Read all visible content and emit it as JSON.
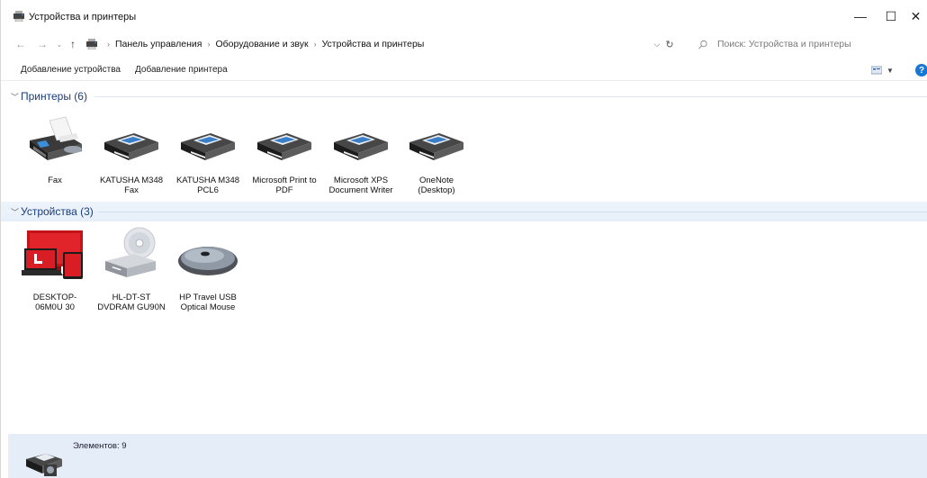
{
  "window": {
    "title": "Устройства и принтеры",
    "minimize": "—",
    "maximize": "☐",
    "close": "✕"
  },
  "address": {
    "path": [
      "Панель управления",
      "Оборудование и звук",
      "Устройства и принтеры"
    ],
    "search_placeholder": "Поиск: Устройства и принтеры"
  },
  "toolbar": {
    "add_device": "Добавление устройства",
    "add_printer": "Добавление принтера",
    "help": "?"
  },
  "groups": {
    "printers": {
      "title": "Принтеры (6)",
      "items": [
        {
          "label": "Fax",
          "icon": "fax-icon"
        },
        {
          "label": "KATUSHA M348 Fax",
          "icon": "printer-icon"
        },
        {
          "label": "KATUSHA M348 PCL6",
          "icon": "printer-icon"
        },
        {
          "label": "Microsoft Print to PDF",
          "icon": "printer-icon"
        },
        {
          "label": "Microsoft XPS Document Writer",
          "icon": "printer-icon"
        },
        {
          "label": "OneNote (Desktop)",
          "icon": "printer-icon"
        }
      ]
    },
    "devices": {
      "title": "Устройства (3)",
      "items": [
        {
          "label": "DESKTOP-06M0U 30",
          "icon": "computer-icon"
        },
        {
          "label": "HL-DT-ST DVDRAM GU90N",
          "icon": "dvd-drive-icon"
        },
        {
          "label": "HP Travel USB Optical Mouse",
          "icon": "mouse-icon"
        }
      ]
    }
  },
  "status": {
    "count": "Элементов: 9"
  },
  "colors": {
    "group_title": "#1b3d7a",
    "status_bar": "#e4edf8",
    "help": "#1677d4"
  }
}
